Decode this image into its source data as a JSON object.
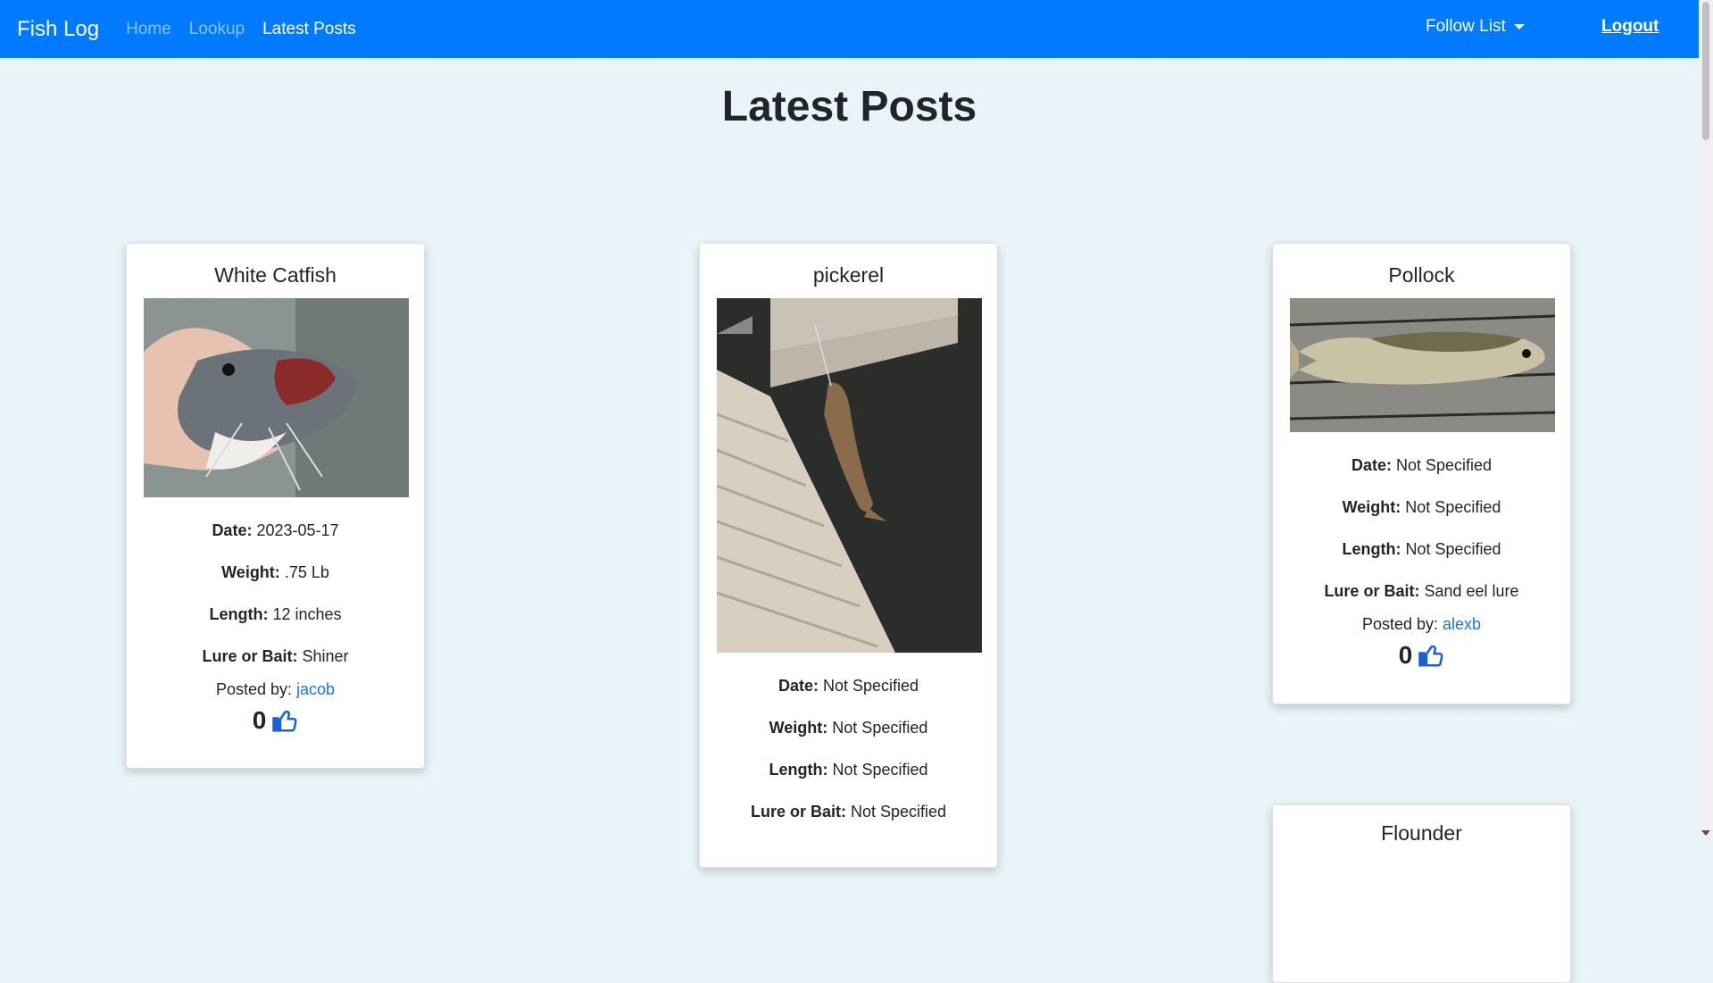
{
  "nav": {
    "brand": "Fish Log",
    "links": [
      "Home",
      "Lookup",
      "Latest Posts"
    ],
    "follow_list": "Follow List",
    "logout": "Logout"
  },
  "page_title": "Latest Posts",
  "colors": {
    "navbar": "#007bff",
    "background": "#e8f4f8",
    "link": "#1a73e8"
  },
  "labels": {
    "date": "Date:",
    "weight": "Weight:",
    "length": "Length:",
    "lure": "Lure or Bait:",
    "posted_by": "Posted by:"
  },
  "posts": [
    {
      "title": "White Catfish",
      "date": "2023-05-17",
      "weight": ".75 Lb",
      "length": "12 inches",
      "lure": "Shiner",
      "author": "jacob",
      "likes": "0"
    },
    {
      "title": "pickerel",
      "date": "Not Specified",
      "weight": "Not Specified",
      "length": "Not Specified",
      "lure": "Not Specified",
      "author": "",
      "likes": ""
    },
    {
      "title": "Pollock",
      "date": "Not Specified",
      "weight": "Not Specified",
      "length": "Not Specified",
      "lure": "Sand eel lure",
      "author": "alexb",
      "likes": "0"
    },
    {
      "title": "Flounder"
    }
  ]
}
